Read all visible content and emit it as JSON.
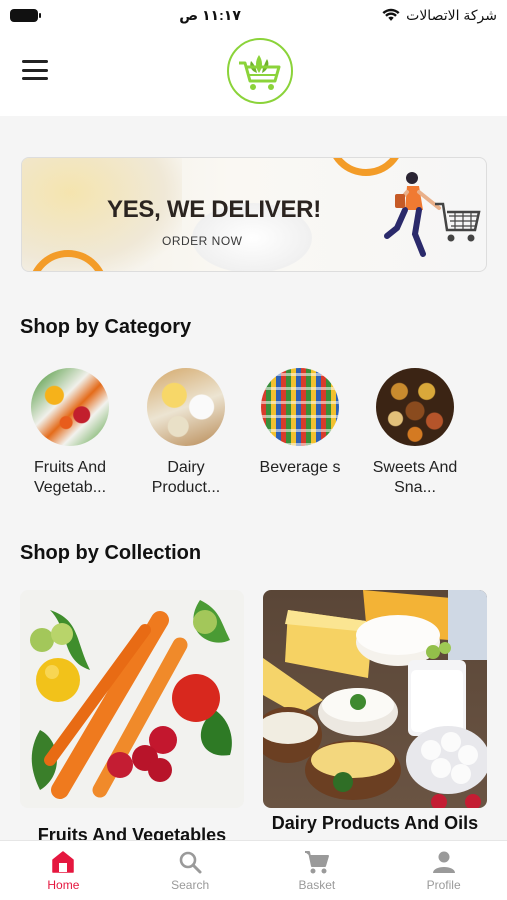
{
  "status_bar": {
    "time": "١١:١٧ ص",
    "carrier": "شركة الاتصالات"
  },
  "header": {
    "logo_icon": "basket-logo-icon",
    "menu_icon": "menu-icon"
  },
  "banner": {
    "title": "YES, WE DELIVER!",
    "subtitle": "ORDER NOW"
  },
  "categories": {
    "title": "Shop by Category",
    "items": [
      {
        "label": "Fruits And Vegetab..."
      },
      {
        "label": "Dairy Product..."
      },
      {
        "label": "Beverage s"
      },
      {
        "label": "Sweets And Sna..."
      }
    ]
  },
  "collections": {
    "title": "Shop by Collection",
    "items": [
      {
        "label": "Fruits And Vegetables"
      },
      {
        "label": "Dairy Products And Oils"
      }
    ]
  },
  "bottom_nav": {
    "accent_color": "#e5173f",
    "inactive_color": "#9a9a9a",
    "items": [
      {
        "label": "Home",
        "icon": "home-icon",
        "active": true
      },
      {
        "label": "Search",
        "icon": "search-icon",
        "active": false
      },
      {
        "label": "Basket",
        "icon": "cart-icon",
        "active": false
      },
      {
        "label": "Profile",
        "icon": "person-icon",
        "active": false
      }
    ]
  }
}
